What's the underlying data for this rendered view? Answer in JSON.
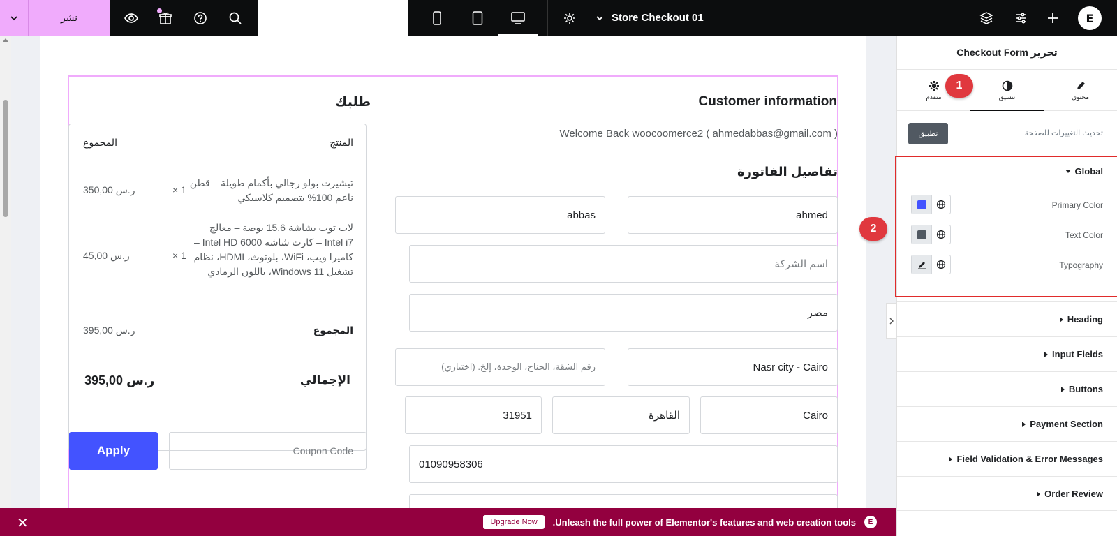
{
  "topbar": {
    "publish_label": "نشر",
    "template_title": "Store Checkout 01",
    "logo_text": "E"
  },
  "form": {
    "customer_info_title": "Customer information",
    "welcome_text": "Welcome Back woocoomerce2 ( ahmedabbas@gmail.com )",
    "billing_title": "تفاصيل الفاتورة",
    "first_name": "ahmed",
    "last_name": "abbas",
    "company_placeholder": "اسم الشركة",
    "country": "مصر",
    "address": "Nasr city - Cairo",
    "address2_placeholder": "رقم الشقة، الجناح، الوحدة، إلخ. (اختياري)",
    "city": "Cairo",
    "state": "القاهرة",
    "postcode": "31951",
    "phone": "01090958306"
  },
  "order": {
    "title": "طلبك",
    "col_product": "المنتج",
    "col_total": "المجموع",
    "items": [
      {
        "name": "تيشيرت بولو رجالي بأكمام طويلة – قطن ناعم 100% بتصميم كلاسيكي",
        "qty": "× 1",
        "price": "350,00 ر.س"
      },
      {
        "name": "لاب توب بشاشة 15.6 بوصة – معالج Intel i7 – كارت شاشة Intel HD 6000 – كاميرا ويب، WiFi، بلوتوث، HDMI، نظام تشغيل Windows 11، باللون الرمادي",
        "qty": "× 1",
        "price": "45,00 ر.س"
      }
    ],
    "subtotal_label": "المجموع",
    "subtotal_value": "395,00 ر.س",
    "total_label": "الإجمالي",
    "total_value": "395,00 ر.س",
    "coupon_placeholder": "Coupon Code",
    "apply_label": "Apply"
  },
  "panel": {
    "title": "تحرير Checkout Form",
    "tabs": [
      {
        "label": "محتوى"
      },
      {
        "label": "تنسيق"
      },
      {
        "label": "متقدم"
      }
    ],
    "update_label": "تحديث التغييرات للصفحة",
    "update_button": "تطبيق",
    "global_title": "Global",
    "global_rows": [
      {
        "label": "Primary Color",
        "swatch": "#4353ff"
      },
      {
        "label": "Text Color",
        "swatch": "#515962"
      },
      {
        "label": "Typography"
      }
    ],
    "sections": [
      "Heading",
      "Input Fields",
      "Buttons",
      "Payment Section",
      "Field Validation & Error Messages",
      "Order Review"
    ]
  },
  "badges": {
    "one": "1",
    "two": "2"
  },
  "promo": {
    "text": ".Unleash the full power of Elementor's features and web creation tools",
    "button": "Upgrade Now"
  },
  "colors": {
    "accent": "#4353ff",
    "publish": "#f0abfc",
    "promo": "#93003f",
    "highlight": "#e02b2b"
  }
}
